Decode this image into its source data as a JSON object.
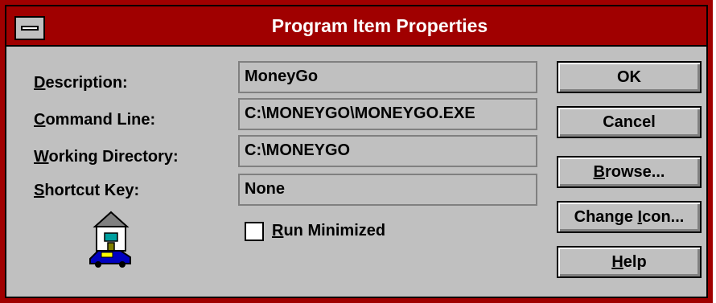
{
  "window": {
    "title": "Program Item Properties"
  },
  "fields": [
    {
      "label": "Description:",
      "value": "MoneyGo"
    },
    {
      "label": "Command Line:",
      "value": "C:\\MONEYGO\\MONEYGO.EXE"
    },
    {
      "label": "Working Directory:",
      "value": "C:\\MONEYGO"
    },
    {
      "label": "Shortcut Key:",
      "value": "None"
    }
  ],
  "options": {
    "run_minimized_label": "Run Minimized",
    "run_minimized_checked": false
  },
  "buttons": {
    "ok": "OK",
    "cancel": "Cancel",
    "browse": "Browse...",
    "change_icon": "Change Icon...",
    "help": "Help"
  },
  "icon": {
    "name": "house-car-icon"
  },
  "colors": {
    "titlebar": "#a00000",
    "dialog_background": "#c0c0c0",
    "title_text": "#ffffff"
  }
}
